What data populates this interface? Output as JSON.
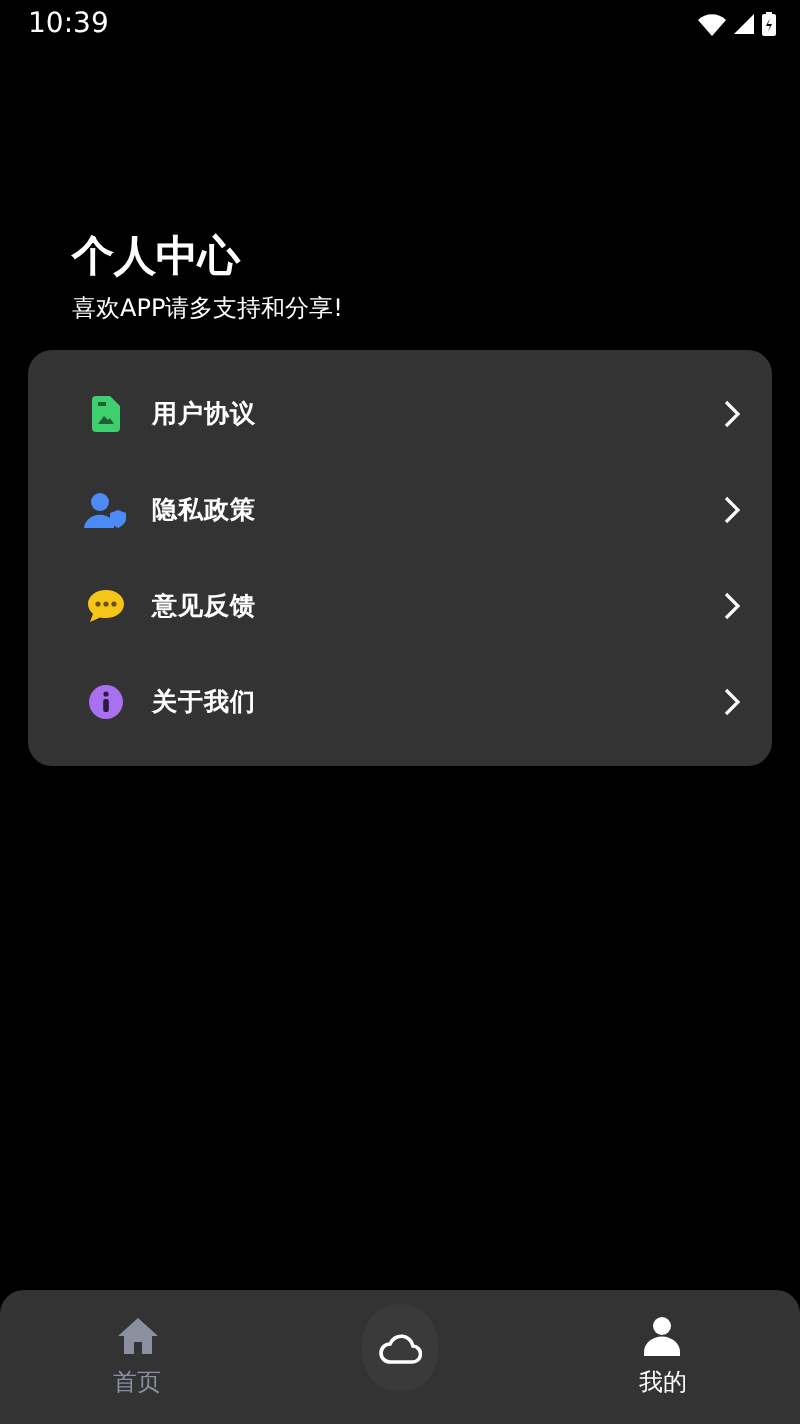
{
  "status_bar": {
    "time": "10:39"
  },
  "header": {
    "title": "个人中心",
    "subtitle": "喜欢APP请多支持和分享!"
  },
  "menu": [
    {
      "label": "用户协议",
      "kind": "document"
    },
    {
      "label": "隐私政策",
      "kind": "privacy"
    },
    {
      "label": "意见反馈",
      "kind": "feedback"
    },
    {
      "label": "关于我们",
      "kind": "info"
    }
  ],
  "bottom_nav": [
    {
      "label": "首页",
      "kind": "home",
      "selected": false
    },
    {
      "kind": "cloud"
    },
    {
      "label": "我的",
      "kind": "profile",
      "selected": true
    }
  ]
}
